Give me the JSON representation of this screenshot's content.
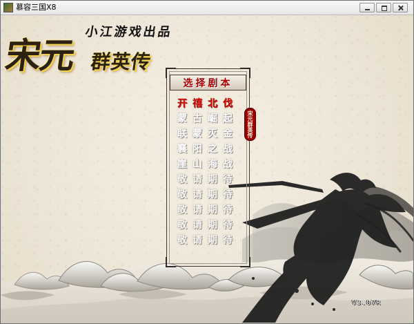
{
  "window": {
    "title": "慕容三国X8",
    "app_icon": "game-icon",
    "controls": [
      "minimize-icon",
      "maximize-icon",
      "close-icon"
    ]
  },
  "branding": {
    "subtitle": "小江游戏出品",
    "main": "宋元",
    "side": "群英传"
  },
  "menu": {
    "header": "选择剧本",
    "items": [
      {
        "label": "开禧北伐",
        "state": "selected"
      },
      {
        "label": "蒙古崛起",
        "state": "normal"
      },
      {
        "label": "联蒙灭金",
        "state": "normal"
      },
      {
        "label": "襄阳之战",
        "state": "normal"
      },
      {
        "label": "崖山海战",
        "state": "normal"
      },
      {
        "label": "敬请期待",
        "state": "disabled"
      },
      {
        "label": "敬请期待",
        "state": "disabled"
      },
      {
        "label": "敬请期待",
        "state": "disabled"
      },
      {
        "label": "敬请期待",
        "state": "disabled"
      },
      {
        "label": "敬请期待",
        "state": "disabled"
      }
    ]
  },
  "seal": {
    "text": "宋元群英传"
  },
  "version": "V3.07R",
  "colors": {
    "selected_text": "#c20000",
    "header_text": "#a10000",
    "seal_red": "#9b0000",
    "logo_gold": "#f4d14a"
  }
}
